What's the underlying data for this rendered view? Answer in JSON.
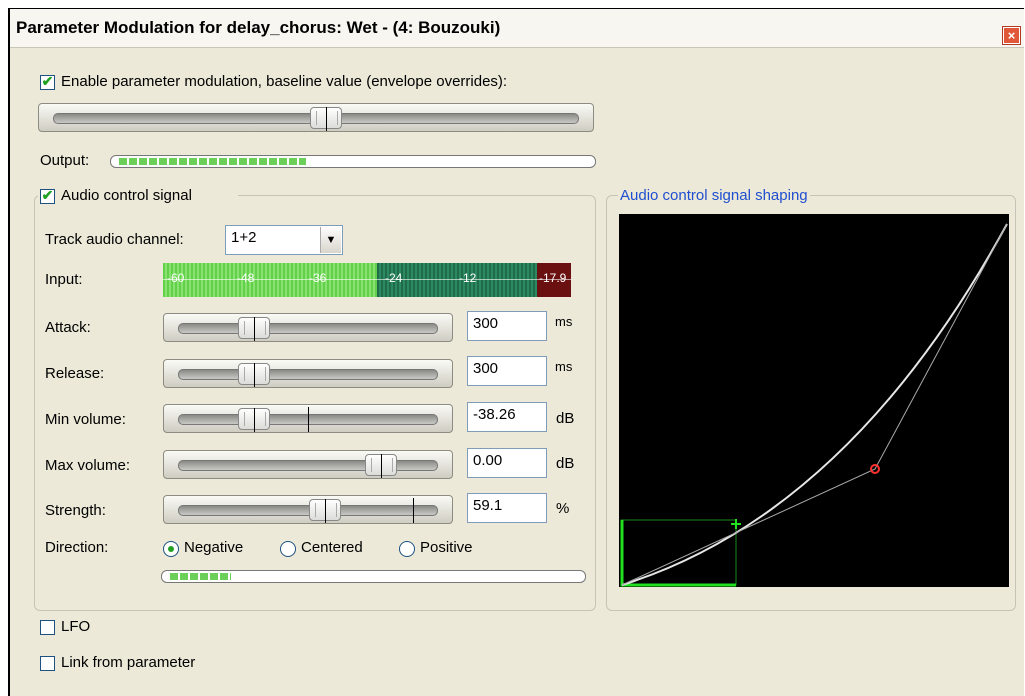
{
  "window": {
    "title": "Parameter Modulation for delay_chorus: Wet - (4: Bouzouki)",
    "close_glyph": "×"
  },
  "baseline": {
    "enable_label": "Enable parameter modulation, baseline value (envelope overrides):",
    "enabled": true,
    "value_fraction": 0.52
  },
  "output": {
    "label": "Output:",
    "level_fraction": 0.4
  },
  "audio_control": {
    "label": "Audio control signal",
    "enabled": true,
    "track_channel_label": "Track audio channel:",
    "track_channel_value": "1+2",
    "input_label": "Input:",
    "input_ticks": [
      "-60",
      "-48",
      "-36",
      "-24",
      "-12",
      "-17.9"
    ],
    "rows": [
      {
        "key": "attack",
        "label": "Attack:",
        "value": "300",
        "unit": "ms",
        "fraction": 0.28
      },
      {
        "key": "release",
        "label": "Release:",
        "value": "300",
        "unit": "ms",
        "fraction": 0.28
      },
      {
        "key": "min-volume",
        "label": "Min volume:",
        "value": "-38.26",
        "unit": "dB",
        "fraction": 0.28,
        "marker": 0.5
      },
      {
        "key": "max-volume",
        "label": "Max volume:",
        "value": "0.00",
        "unit": "dB",
        "fraction": 0.8
      },
      {
        "key": "strength",
        "label": "Strength:",
        "value": "59.1",
        "unit": "%",
        "fraction": 0.57,
        "marker": 0.93
      }
    ],
    "direction_label": "Direction:",
    "direction_options": [
      "Negative",
      "Centered",
      "Positive"
    ],
    "direction_selected": "Negative",
    "direction_level_fraction": 0.15
  },
  "shaping": {
    "label": "Audio control signal shaping",
    "colors": {
      "background": "#000000",
      "curve": "#e6e6e6",
      "control_point": "#ff3030",
      "marker": "#20e020"
    }
  },
  "lfo": {
    "label": "LFO",
    "enabled": false
  },
  "link": {
    "label": "Link from parameter",
    "enabled": false
  }
}
